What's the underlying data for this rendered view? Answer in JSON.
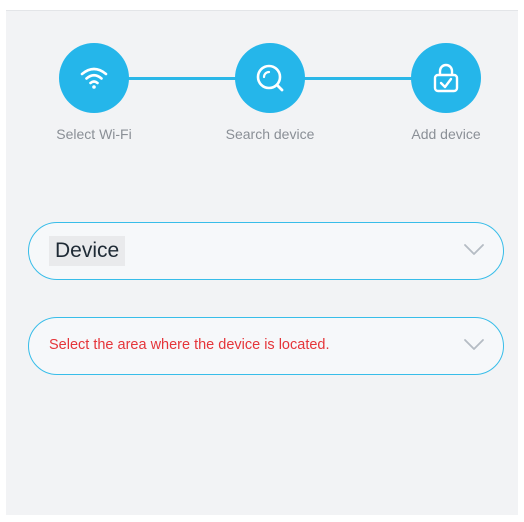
{
  "steps": [
    {
      "label": "Select Wi-Fi",
      "icon": "wifi-icon"
    },
    {
      "label": "Search device",
      "icon": "search-icon"
    },
    {
      "label": "Add device",
      "icon": "lock-check-icon"
    }
  ],
  "form": {
    "device_select": {
      "value": "Device",
      "icon": "chevron-down-icon"
    },
    "area_select": {
      "placeholder": "Select the area where the device is located.",
      "icon": "chevron-down-icon"
    }
  },
  "colors": {
    "accent": "#25b6ea",
    "placeholder_red": "#e5353a",
    "background": "#f2f3f5"
  }
}
